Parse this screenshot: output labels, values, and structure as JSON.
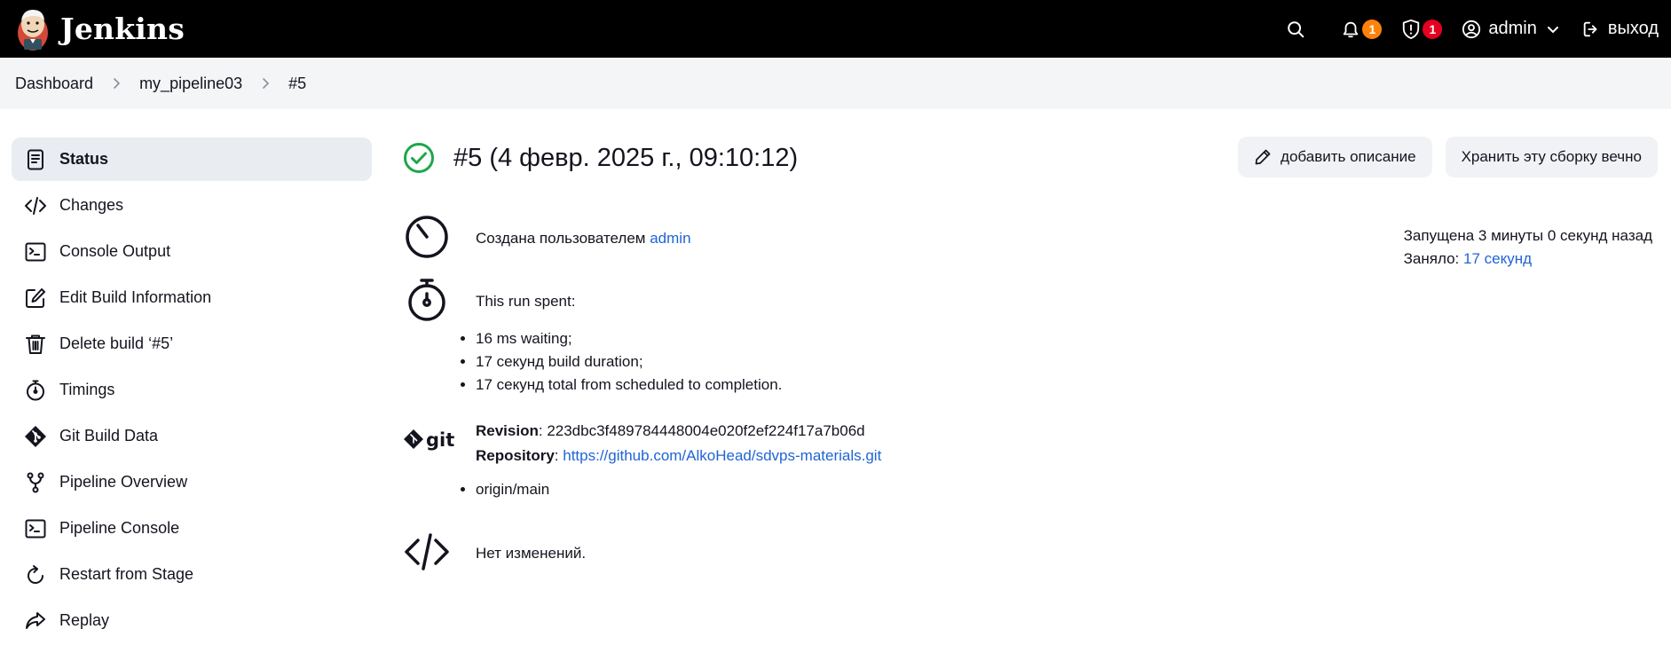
{
  "header": {
    "brand": "Jenkins",
    "notifications_count": "1",
    "security_count": "1",
    "user": "admin",
    "logout": "выход"
  },
  "breadcrumb": [
    "Dashboard",
    "my_pipeline03",
    "#5"
  ],
  "sidebar": {
    "items": [
      {
        "label": "Status",
        "icon": "status-icon"
      },
      {
        "label": "Changes",
        "icon": "code-icon"
      },
      {
        "label": "Console Output",
        "icon": "terminal-icon"
      },
      {
        "label": "Edit Build Information",
        "icon": "edit-icon"
      },
      {
        "label": "Delete build ‘#5’",
        "icon": "trash-icon"
      },
      {
        "label": "Timings",
        "icon": "stopwatch-icon"
      },
      {
        "label": "Git Build Data",
        "icon": "git-icon"
      },
      {
        "label": "Pipeline Overview",
        "icon": "branch-icon"
      },
      {
        "label": "Pipeline Console",
        "icon": "terminal-icon"
      },
      {
        "label": "Restart from Stage",
        "icon": "restart-icon"
      },
      {
        "label": "Replay",
        "icon": "replay-icon"
      }
    ]
  },
  "build": {
    "title": "#5 (4 февр. 2025 г., 09:10:12)",
    "add_description": "добавить описание",
    "keep_forever": "Хранить эту сборку вечно",
    "started_ago": "Запущена 3 минуты 0 секунд назад",
    "took_label": "Заняло: ",
    "took_value": "17 секунд",
    "created_by_label": "Создана пользователем ",
    "created_by_user": "admin",
    "run_spent_label": "This run spent:",
    "run_spent": [
      "16 ms waiting;",
      "17 секунд build duration;",
      "17 секунд total from scheduled to completion."
    ],
    "revision_label": "Revision",
    "revision": "223dbc3f489784448004e020f2ef224f17a7b06d",
    "repository_label": "Repository",
    "repository": "https://github.com/AlkoHead/sdvps-materials.git",
    "branches": [
      "origin/main"
    ],
    "no_changes": "Нет изменений."
  },
  "colors": {
    "header_bg": "#000000",
    "link": "#2064d6",
    "success": "#1ea64b",
    "badge_orange": "#fe820a",
    "badge_red": "#e6001f"
  }
}
